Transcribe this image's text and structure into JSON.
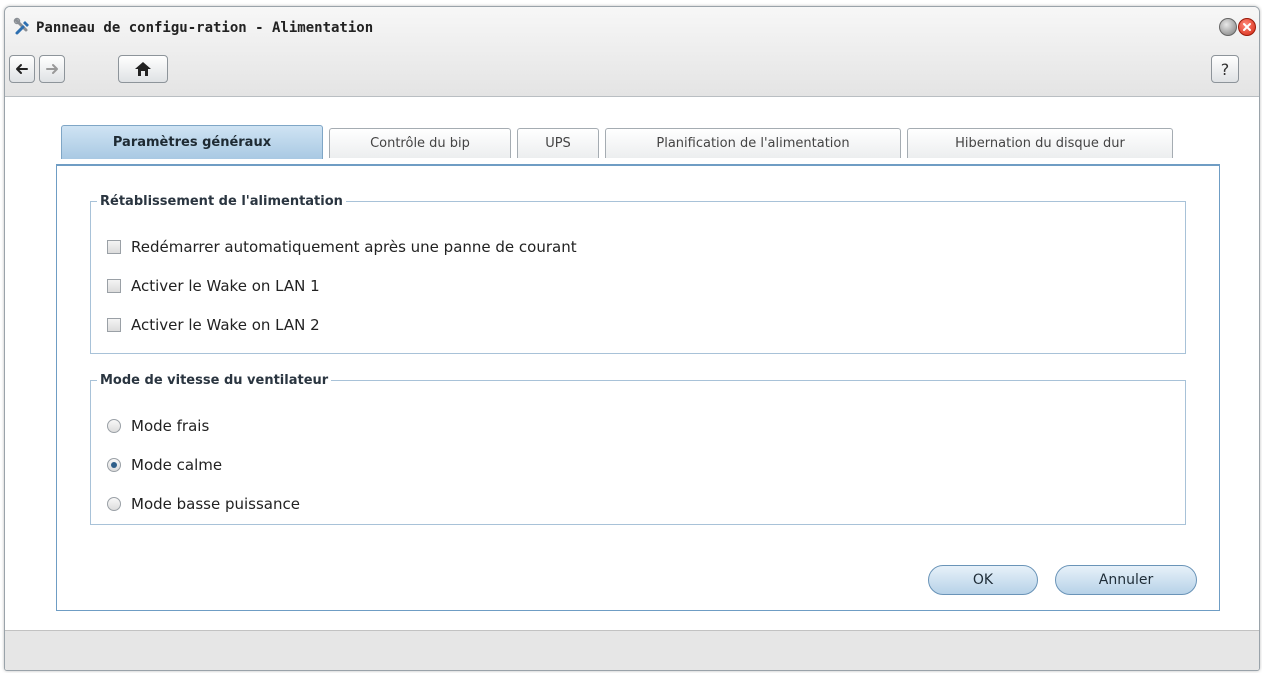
{
  "window": {
    "title": "Panneau de configu-ration - Alimentation",
    "help_label": "?"
  },
  "tabs": [
    {
      "label": "Paramètres généraux",
      "active": true
    },
    {
      "label": "Contrôle du bip",
      "active": false
    },
    {
      "label": "UPS",
      "active": false
    },
    {
      "label": "Planification de l'alimentation",
      "active": false
    },
    {
      "label": "Hibernation du disque dur",
      "active": false
    }
  ],
  "power_recovery": {
    "legend": "Rétablissement de l'alimentation",
    "options": [
      {
        "label": "Redémarrer automatiquement après une panne de courant",
        "checked": false
      },
      {
        "label": "Activer le Wake on LAN 1",
        "checked": false
      },
      {
        "label": "Activer le Wake on LAN 2",
        "checked": false
      }
    ]
  },
  "fan_mode": {
    "legend": "Mode de vitesse du ventilateur",
    "options": [
      {
        "label": "Mode frais",
        "selected": false
      },
      {
        "label": "Mode calme",
        "selected": true
      },
      {
        "label": "Mode basse puissance",
        "selected": false
      }
    ]
  },
  "buttons": {
    "ok_label": "OK",
    "cancel_label": "Annuler"
  },
  "colors": {
    "active_tab": "#a9c9e3",
    "panel_border": "#6f9dc4",
    "close_button": "#d42410"
  }
}
